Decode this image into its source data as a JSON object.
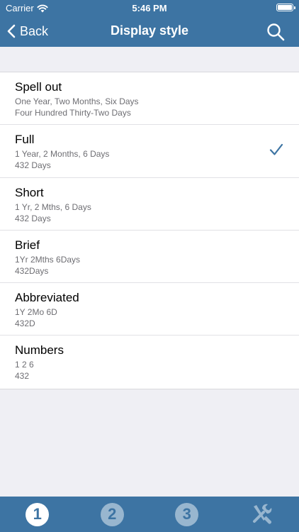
{
  "status_bar": {
    "carrier": "Carrier",
    "time": "5:46 PM"
  },
  "navbar": {
    "back_label": "Back",
    "title": "Display style",
    "search_icon": "search-icon"
  },
  "styles": [
    {
      "title": "Spell out",
      "line1": "One Year, Two Months, Six Days",
      "line2": "Four Hundred Thirty-Two Days",
      "selected": false
    },
    {
      "title": "Full",
      "line1": "1 Year, 2 Months, 6 Days",
      "line2": "432 Days",
      "selected": true
    },
    {
      "title": "Short",
      "line1": "1 Yr, 2 Mths, 6 Days",
      "line2": "432 Days",
      "selected": false
    },
    {
      "title": "Brief",
      "line1": "1Yr 2Mths 6Days",
      "line2": "432Days",
      "selected": false
    },
    {
      "title": "Abbreviated",
      "line1": "1Y 2Mo 6D",
      "line2": "432D",
      "selected": false
    },
    {
      "title": "Numbers",
      "line1": "1 2 6",
      "line2": "432",
      "selected": false
    }
  ],
  "tabbar": {
    "tabs": [
      {
        "label": "1",
        "active": true
      },
      {
        "label": "2",
        "active": false
      },
      {
        "label": "3",
        "active": false
      },
      {
        "icon": "tools-icon",
        "active": false
      }
    ]
  },
  "colors": {
    "accent": "#3d74a3",
    "checkmark": "#3d74a3",
    "background": "#efeff4"
  }
}
